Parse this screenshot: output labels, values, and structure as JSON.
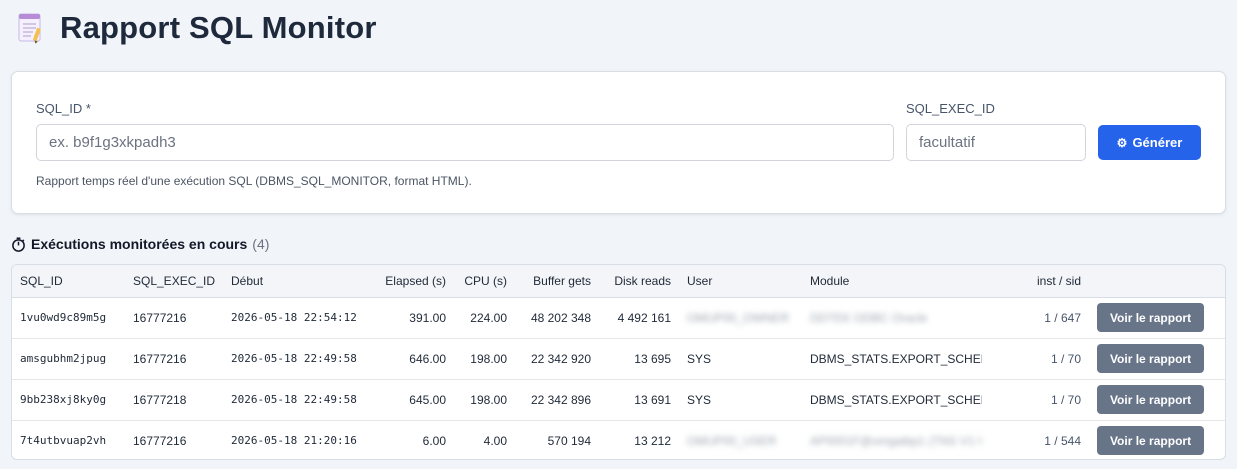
{
  "header": {
    "title": "Rapport SQL Monitor",
    "icon": "document-icon"
  },
  "form": {
    "sql_id_label": "SQL_ID *",
    "sql_id_placeholder": "ex. b9f1g3xkpadh3",
    "sql_id_value": "",
    "exec_id_label": "SQL_EXEC_ID",
    "exec_id_placeholder": "facultatif",
    "exec_id_value": "",
    "generate_label": "Générer",
    "generate_icon": "gear-icon",
    "help_text": "Rapport temps réel d'une exécution SQL (DBMS_SQL_MONITOR, format HTML).",
    "accent_color": "#2563eb"
  },
  "executions": {
    "heading": "Exécutions monitorées en cours",
    "count": "(4)",
    "heading_icon": "stopwatch-icon",
    "columns": [
      "SQL_ID",
      "SQL_EXEC_ID",
      "Début",
      "Elapsed (s)",
      "CPU (s)",
      "Buffer gets",
      "Disk reads",
      "User",
      "Module",
      "inst / sid",
      ""
    ],
    "rows": [
      {
        "sql_id": "1vu0wd9c89m5g",
        "exec_id": "16777216",
        "start": "2026-05-18 22:54:12",
        "elapsed": "391.00",
        "cpu": "224.00",
        "buffer_gets": "48 202 348",
        "disk_reads": "4 492 161",
        "user": "OMUP00_OWNER",
        "user_blurred": true,
        "module": "DDTEK ODBC Oracle",
        "module_blurred": true,
        "inst_sid": "1 / 647",
        "action_label": "Voir le rapport"
      },
      {
        "sql_id": "amsgubhm2jpug",
        "exec_id": "16777216",
        "start": "2026-05-18 22:49:58",
        "elapsed": "646.00",
        "cpu": "198.00",
        "buffer_gets": "22 342 920",
        "disk_reads": "13 695",
        "user": "SYS",
        "user_blurred": false,
        "module": "DBMS_STATS.EXPORT_SCHEMA_STATS",
        "module_blurred": false,
        "inst_sid": "1 / 70",
        "action_label": "Voir le rapport"
      },
      {
        "sql_id": "9bb238xj8ky0g",
        "exec_id": "16777218",
        "start": "2026-05-18 22:49:58",
        "elapsed": "645.00",
        "cpu": "198.00",
        "buffer_gets": "22 342 896",
        "disk_reads": "13 691",
        "user": "SYS",
        "user_blurred": false,
        "module": "DBMS_STATS.EXPORT_SCHEMA_STATS",
        "module_blurred": false,
        "inst_sid": "1 / 70",
        "action_label": "Voir le rapport"
      },
      {
        "sql_id": "7t4utbvuap2vh",
        "exec_id": "16777216",
        "start": "2026-05-18 21:20:16",
        "elapsed": "6.00",
        "cpu": "4.00",
        "buffer_gets": "570 194",
        "disk_reads": "13 212",
        "user": "OMUP00_USER",
        "user_blurred": true,
        "module": "AP0001F@omgaibp1 (TNS V1-V3)",
        "module_blurred": true,
        "inst_sid": "1 / 544",
        "action_label": "Voir le rapport"
      }
    ]
  }
}
